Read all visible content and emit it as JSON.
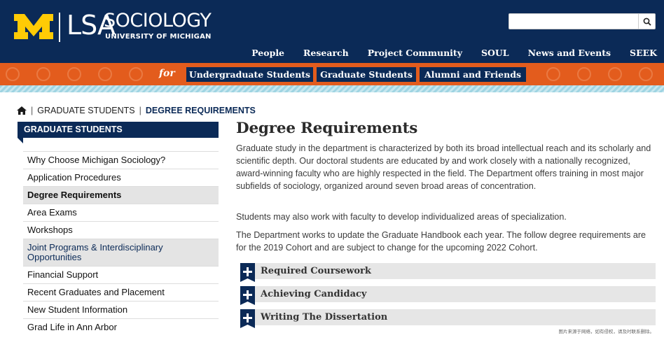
{
  "header": {
    "logo_lsa": "LSA",
    "dept_name": "SOCIOLOGY",
    "university": "UNIVERSITY OF MICHIGAN",
    "search": {
      "placeholder": "",
      "button_icon": "search-icon"
    },
    "nav": [
      "People",
      "Research",
      "Project Community",
      "SOUL",
      "News and Events",
      "SEEK"
    ],
    "colors": {
      "navy": "#0b2a57",
      "maize": "#ffcb05",
      "orange": "#e35c1d"
    }
  },
  "audience": {
    "for_label": "for",
    "buttons": [
      "Undergraduate Students",
      "Graduate Students",
      "Alumni and Friends"
    ]
  },
  "breadcrumb": {
    "home_icon": "home-icon",
    "items": [
      "GRADUATE STUDENTS",
      "DEGREE REQUIREMENTS"
    ]
  },
  "sidebar": {
    "heading": "GRADUATE STUDENTS",
    "items": [
      "Why Choose Michigan Sociology?",
      "Application Procedures",
      "Degree Requirements",
      "Area Exams",
      "Workshops",
      "Joint Programs & Interdisciplinary Opportunities",
      "Financial Support",
      "Recent Graduates and Placement",
      "New Student Information",
      "Grad Life in Ann Arbor"
    ],
    "active_item": "Degree Requirements"
  },
  "main": {
    "title": "Degree Requirements",
    "paragraphs": [
      "Graduate study in the department is characterized by both its broad intellectual reach and its scholarly and scientific depth. Our doctoral students are educated by and work closely with a nationally recognized, award-winning faculty who are highly respected in the field. The Department offers training in most major subfields of sociology, organized around seven broad areas of concentration.",
      "Students may also work with faculty to develop individualized areas of specialization.",
      "The Department works to update the Graduate Handbook each year. The follow degree requirements are for the 2019 Cohort and are subject to change for the upcoming 2022 Cohort."
    ],
    "accordions": [
      "Required Coursework",
      "Achieving Candidacy",
      "Writing The Dissertation"
    ]
  },
  "watermark": "图片来源于网络，如有侵权，请及时联系删除。"
}
